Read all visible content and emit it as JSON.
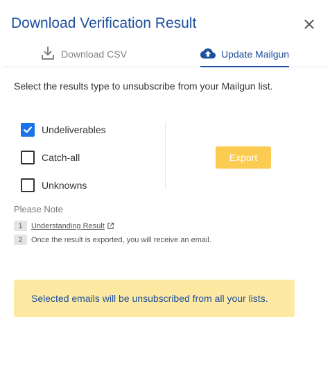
{
  "dialog": {
    "title": "Download Verification Result"
  },
  "tabs": [
    {
      "label": "Download CSV",
      "icon": "download-icon",
      "active": false
    },
    {
      "label": "Update Mailgun",
      "icon": "cloud-upload-icon",
      "active": true
    }
  ],
  "instruction": "Select the results type to unsubscribe from your Mailgun list.",
  "options": [
    {
      "label": "Undeliverables",
      "checked": true
    },
    {
      "label": "Catch-all",
      "checked": false
    },
    {
      "label": "Unknowns",
      "checked": false
    }
  ],
  "export_button": {
    "label": "Export"
  },
  "note": {
    "title": "Please Note",
    "items": [
      {
        "number": "1",
        "text": "Understanding Result",
        "is_link": true
      },
      {
        "number": "2",
        "text": "Once the result is exported, you will receive an email.",
        "is_link": false
      }
    ]
  },
  "alert": {
    "text": "Selected emails will be unsubscribed from all your lists."
  },
  "colors": {
    "primary": "#1c4f9c",
    "checkbox": "#1a73e8",
    "export_button": "#fbc02d",
    "alert_bg": "#fde9a2"
  }
}
